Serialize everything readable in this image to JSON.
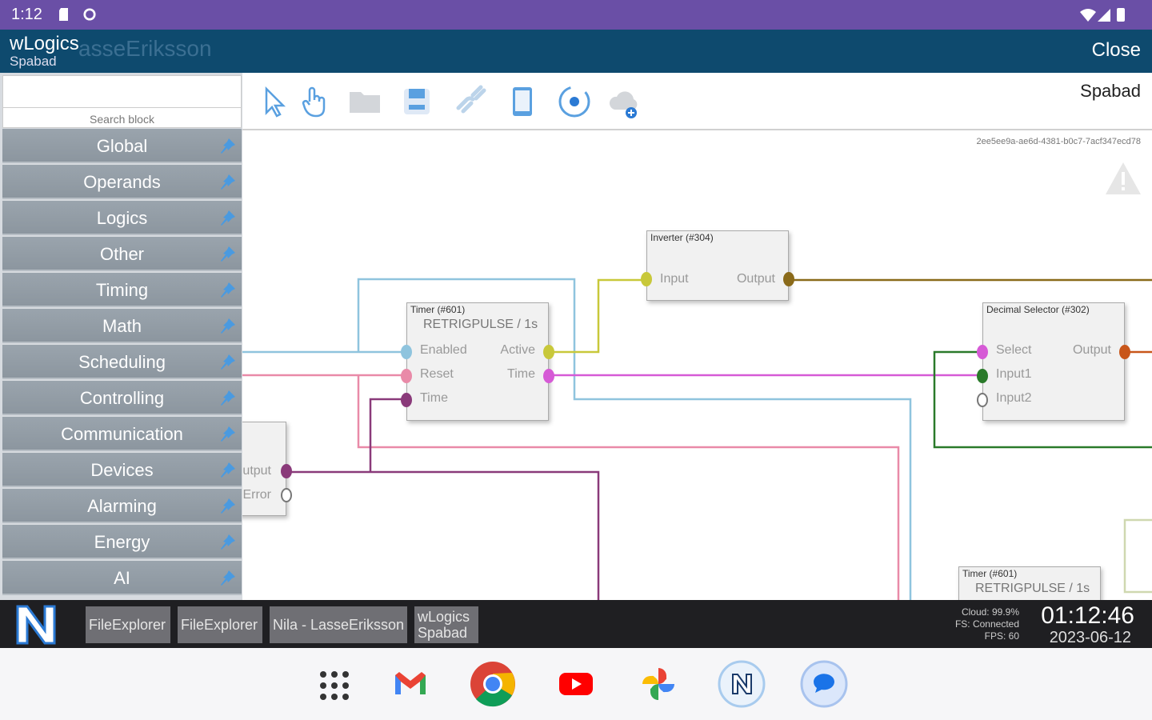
{
  "status_bar": {
    "time": "1:12"
  },
  "app_bar": {
    "title": "wLogics",
    "subtitle": "Spabad",
    "ghost_text": "asseEriksson",
    "close_label": "Close"
  },
  "sidebar": {
    "search_placeholder": "",
    "search_label": "Search block",
    "categories": [
      {
        "label": "Global"
      },
      {
        "label": "Operands"
      },
      {
        "label": "Logics"
      },
      {
        "label": "Other"
      },
      {
        "label": "Timing"
      },
      {
        "label": "Math"
      },
      {
        "label": "Scheduling"
      },
      {
        "label": "Controlling"
      },
      {
        "label": "Communication"
      },
      {
        "label": "Devices"
      },
      {
        "label": "Alarming"
      },
      {
        "label": "Energy"
      },
      {
        "label": "AI"
      }
    ]
  },
  "toolbar": {
    "tools": [
      "select-cursor-icon",
      "hand-pointer-icon",
      "folder-icon",
      "save-icon",
      "link-icon",
      "phone-preview-icon",
      "settings-sync-icon",
      "cloud-add-icon"
    ],
    "document_title": "Spabad"
  },
  "canvas": {
    "guid": "2ee5ee9a-ae6d-4381-b0c7-7acf347ecd78",
    "blocks": {
      "inverter": {
        "title": "Inverter (#304)",
        "inputs": [
          "Input"
        ],
        "outputs": [
          "Output"
        ]
      },
      "timer": {
        "title": "Timer (#601)",
        "subtitle": "RETRIGPULSE / 1s",
        "inputs": [
          "Enabled",
          "Reset",
          "Time"
        ],
        "outputs": [
          "Active",
          "Time"
        ]
      },
      "decimal_selector": {
        "title": "Decimal Selector (#302)",
        "inputs": [
          "Select",
          "Input1",
          "Input2"
        ],
        "outputs": [
          "Output"
        ]
      },
      "partial_left": {
        "outputs": [
          "Output",
          "Error"
        ]
      },
      "timer_bottom": {
        "title": "Timer (#601)",
        "subtitle": "RETRIGPULSE / 1s"
      }
    },
    "colors": {
      "blue_wire": "#8fc4de",
      "pink_wire": "#e98aa8",
      "purple_wire": "#8a3a7a",
      "yellow_wire": "#c8c83a",
      "olive_wire": "#8a6a1a",
      "magenta_wire": "#d65ad6",
      "green_wire": "#2a7a2a"
    }
  },
  "taskbar": {
    "tasks": [
      {
        "label": "FileExplorer"
      },
      {
        "label": "FileExplorer"
      },
      {
        "label": "Nila - LasseEriksson"
      },
      {
        "label": "wLogics",
        "sub": "Spabad"
      }
    ],
    "sys": {
      "cloud": "Cloud: 99.9%",
      "fs": "FS: Connected",
      "fps": "FPS: 60"
    },
    "clock": "01:12:46",
    "date": "2023-06-12"
  },
  "dock": {
    "apps": [
      "apps-grid-icon",
      "gmail-icon",
      "chrome-icon",
      "youtube-icon",
      "photos-icon",
      "nila-app-icon",
      "messages-icon"
    ]
  }
}
